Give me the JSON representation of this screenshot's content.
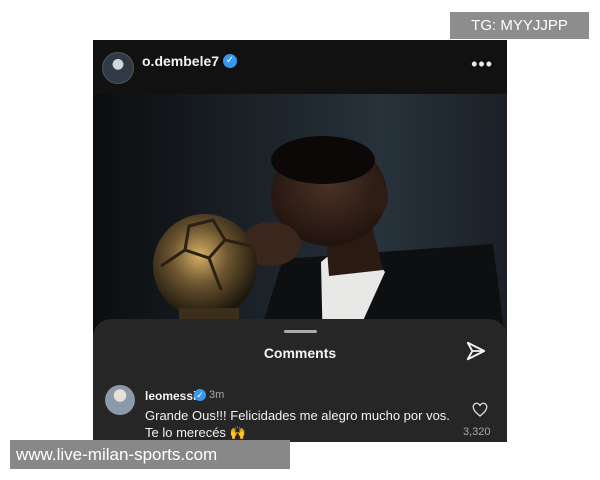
{
  "post": {
    "username": "o.dembele7",
    "verified_icon": "verified-badge-icon",
    "more_icon": "more-options-icon"
  },
  "comments_panel": {
    "title": "Comments",
    "share_icon": "paper-plane-icon"
  },
  "comment": {
    "username": "leomessi",
    "time": "3m",
    "text": "Grande Ous!!! Felicidades me alegro mucho por vos. Te lo merecés 🙌",
    "likes": "3,320",
    "like_icon": "heart-outline-icon"
  },
  "watermarks": {
    "tg": "TG: MYYJJPP",
    "site": "www.live-milan-sports.com"
  },
  "colors": {
    "verified_blue": "#3897f0",
    "sheet_bg": "#262626"
  }
}
